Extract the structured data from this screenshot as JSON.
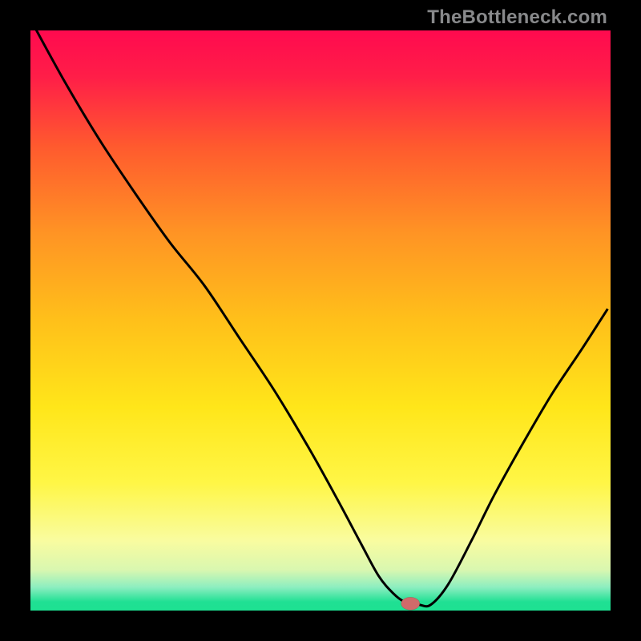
{
  "watermark": "TheBottleneck.com",
  "chart_data": {
    "type": "line",
    "title": "",
    "xlabel": "",
    "ylabel": "",
    "xlim": [
      0,
      100
    ],
    "ylim": [
      0,
      100
    ],
    "grid": false,
    "legend": false,
    "background": {
      "type": "vertical-gradient",
      "stops": [
        {
          "pos": 0.0,
          "color": "#ff0a4f"
        },
        {
          "pos": 0.08,
          "color": "#ff1e48"
        },
        {
          "pos": 0.2,
          "color": "#ff5a2e"
        },
        {
          "pos": 0.35,
          "color": "#ff9424"
        },
        {
          "pos": 0.5,
          "color": "#ffc01a"
        },
        {
          "pos": 0.65,
          "color": "#ffe61a"
        },
        {
          "pos": 0.78,
          "color": "#fff646"
        },
        {
          "pos": 0.88,
          "color": "#f9fca0"
        },
        {
          "pos": 0.93,
          "color": "#d9f7b0"
        },
        {
          "pos": 0.96,
          "color": "#8ceec0"
        },
        {
          "pos": 0.985,
          "color": "#1fe093"
        },
        {
          "pos": 1.0,
          "color": "#1ee192"
        }
      ]
    },
    "series": [
      {
        "name": "bottleneck-curve",
        "stroke": "#000000",
        "stroke_width": 3,
        "x": [
          0.5,
          6,
          12,
          18,
          24,
          30,
          36,
          42,
          48,
          53,
          57,
          60,
          62.5,
          64.5,
          67,
          69,
          72,
          76,
          80,
          85,
          90,
          95,
          99.5
        ],
        "y": [
          101,
          91,
          81,
          72,
          63.5,
          56,
          47,
          38,
          28,
          19,
          11.5,
          6,
          3,
          1.5,
          1,
          1,
          4.5,
          12,
          20,
          29,
          37.5,
          45,
          52
        ]
      }
    ],
    "marker": {
      "name": "optimal-point",
      "x": 65.5,
      "y": 1.2,
      "rx": 1.6,
      "ry": 1.1,
      "fill": "#d06a6a",
      "stroke": "#7a3a3a"
    }
  }
}
